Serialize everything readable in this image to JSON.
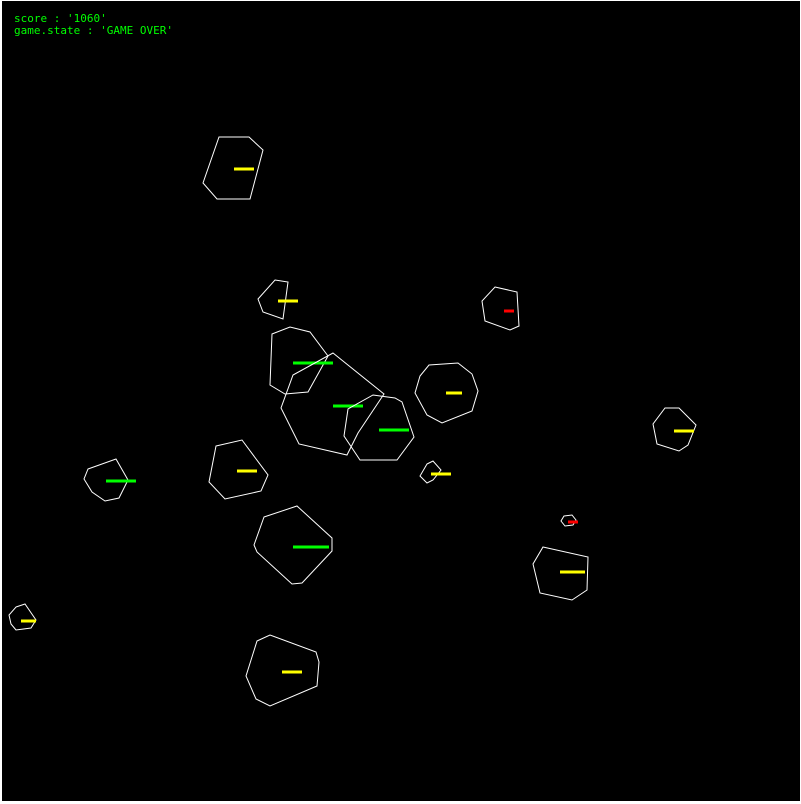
{
  "hud": {
    "score_label": "score : ",
    "score_value": "'1060'",
    "state_label": "game.state : ",
    "state_value": "'GAME OVER'"
  },
  "colors": {
    "background": "#000000",
    "asteroid_outline": "#ffffff",
    "hud_text": "#00ff00",
    "health_high": "#00ff00",
    "health_mid": "#ffff00",
    "health_low": "#ff0000"
  },
  "asteroids": [
    {
      "name": "asteroid-1",
      "health": "mid"
    },
    {
      "name": "asteroid-2",
      "health": "mid"
    },
    {
      "name": "asteroid-3",
      "health": "low"
    },
    {
      "name": "asteroid-4",
      "health": "high"
    },
    {
      "name": "asteroid-5",
      "health": "high"
    },
    {
      "name": "asteroid-6",
      "health": "high"
    },
    {
      "name": "asteroid-7",
      "health": "mid"
    },
    {
      "name": "asteroid-8",
      "health": "mid"
    },
    {
      "name": "asteroid-9",
      "health": "high"
    },
    {
      "name": "asteroid-10",
      "health": "mid"
    },
    {
      "name": "asteroid-11",
      "health": "mid"
    },
    {
      "name": "asteroid-12",
      "health": "high"
    },
    {
      "name": "asteroid-13",
      "health": "low"
    },
    {
      "name": "asteroid-14",
      "health": "mid"
    },
    {
      "name": "asteroid-15",
      "health": "mid"
    },
    {
      "name": "asteroid-16",
      "health": "mid"
    }
  ]
}
